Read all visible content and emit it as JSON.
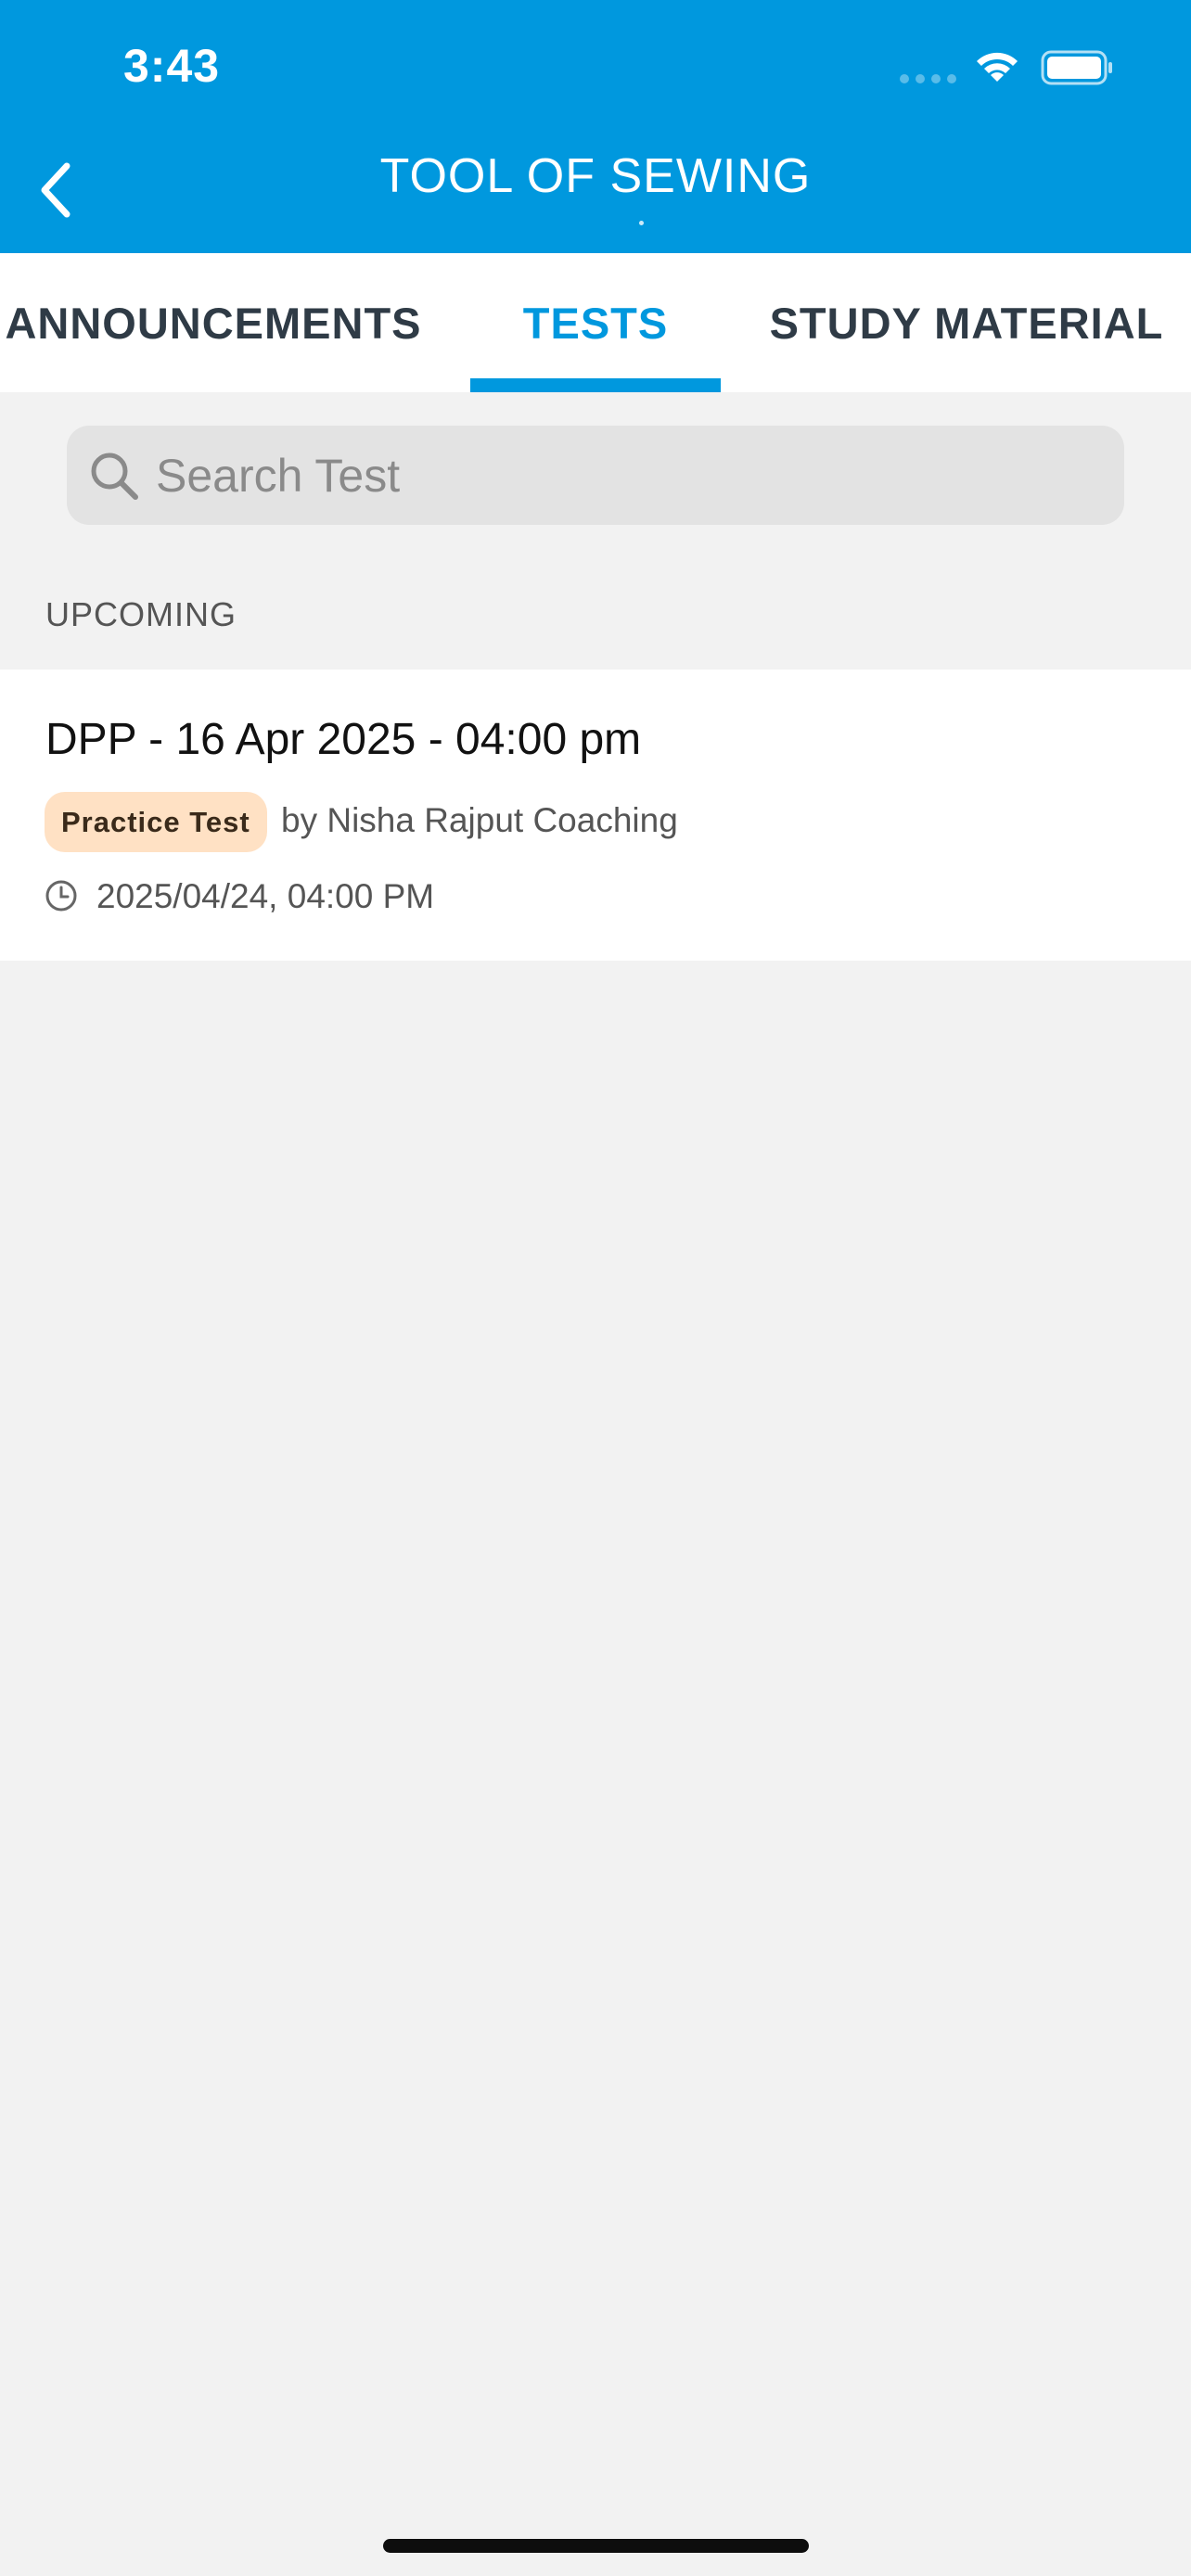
{
  "status_bar": {
    "time": "3:43"
  },
  "header": {
    "title": "TOOL OF SEWING"
  },
  "tabs": [
    {
      "label": "ANNOUNCEMENTS",
      "active": false
    },
    {
      "label": "TESTS",
      "active": true
    },
    {
      "label": "STUDY MATERIAL",
      "active": false
    }
  ],
  "search": {
    "placeholder": "Search Test",
    "value": ""
  },
  "section": {
    "label": "UPCOMING"
  },
  "tests": [
    {
      "title": "DPP - 16 Apr 2025 - 04:00 pm",
      "badge": "Practice Test",
      "by": "by Nisha Rajput Coaching",
      "date": "2025/04/24, 04:00 PM"
    }
  ],
  "colors": {
    "brand": "#0098de",
    "badge_bg": "#ffe1c4",
    "background": "#f2f2f2"
  },
  "icons": {
    "back": "chevron-left-icon",
    "search": "search-icon",
    "clock": "clock-icon",
    "wifi": "wifi-icon",
    "battery": "battery-icon"
  }
}
